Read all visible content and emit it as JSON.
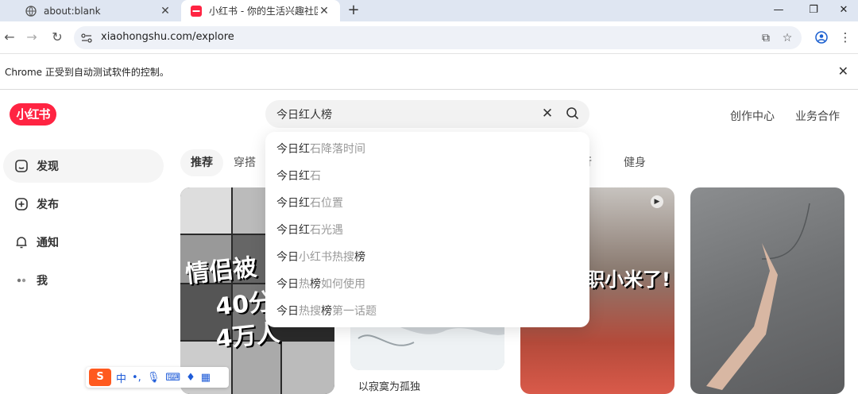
{
  "browser": {
    "tabs": [
      {
        "title": "about:blank",
        "favicon": "globe-icon"
      },
      {
        "title": "小红书 - 你的生活兴趣社区",
        "favicon": "xiaohongshu-favicon-icon",
        "badge": "小红书"
      }
    ],
    "url": "xiaohongshu.com/explore",
    "infobar_message": "Chrome 正受到自动测试软件的控制。"
  },
  "site": {
    "logo": "小红书",
    "search": {
      "value": "今日红人榜"
    },
    "top_links": [
      "创作中心",
      "业务合作"
    ],
    "sidebar": [
      {
        "label": "发现",
        "icon": "home-icon",
        "active": true
      },
      {
        "label": "发布",
        "icon": "plus-circle-icon"
      },
      {
        "label": "通知",
        "icon": "bell-icon"
      },
      {
        "label": "我",
        "icon": "avatar-icon"
      }
    ],
    "channels": [
      "推荐",
      "穿搭",
      "行",
      "健身"
    ],
    "suggestions": [
      {
        "hl": "今日红",
        "rest": "石降落时间"
      },
      {
        "hl": "今日红",
        "rest": "石"
      },
      {
        "hl": "今日红",
        "rest": "石位置"
      },
      {
        "hl": "今日红",
        "rest": "石光遇"
      },
      {
        "hl": "今日",
        "mid": "小红书热搜",
        "hl2": "榜"
      },
      {
        "hl": "今日",
        "mid": "热",
        "hl2": "榜",
        "rest": "如何使用"
      },
      {
        "hl": "今日",
        "mid": "热搜",
        "hl2": "榜",
        "rest": "第一话题"
      }
    ],
    "feed": {
      "card1_overlay": [
        "情侣被",
        "40分",
        "4万人"
      ],
      "card3_overlay": "职小米了!",
      "card2_caption": "以寂寞为孤独"
    }
  },
  "ime": {
    "lang": "中",
    "punct": "•,"
  },
  "colors": {
    "brand": "#ff2442",
    "tabstrip": "#dfe6f2"
  }
}
